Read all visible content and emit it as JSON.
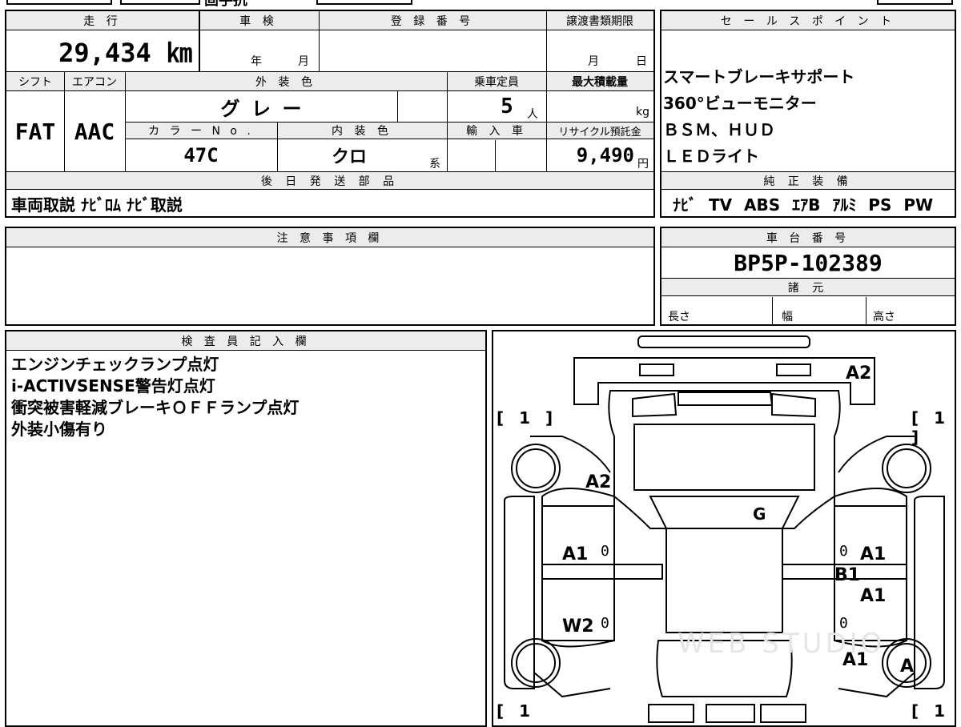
{
  "top_strip_text": "固手抗",
  "main": {
    "mileage_label": "走 行",
    "mileage_value": "29,434 ㎞",
    "inspection_label": "車 検",
    "inspection_year": "年",
    "inspection_month": "月",
    "registration_label": "登 録 番 号",
    "transfer_label": "譲渡書類期限",
    "transfer_month": "月",
    "transfer_day": "日",
    "shift_label": "シフト",
    "ac_label": "エアコン",
    "exterior_label": "外 装 色",
    "capacity_label": "乗車定員",
    "load_label": "最大積載量",
    "shift_value": "FAT",
    "ac_value": "AAC",
    "exterior_value": "グ レ ー",
    "capacity_value": "5",
    "capacity_unit": "人",
    "load_unit": "kg",
    "color_no_label": "カ ラ ー N o .",
    "interior_label": "内 装 色",
    "import_label": "輸 入 車",
    "recycle_label": "リサイクル預託金",
    "color_no_value": "47C",
    "interior_value": "クロ",
    "interior_suffix": "系",
    "recycle_value": "9,490",
    "recycle_unit": "円",
    "later_parts_label": "後 日 発 送 部 品",
    "later_parts_value": "車両取説 ﾅﾋﾞﾛﾑ ﾅﾋﾞ取説"
  },
  "sales": {
    "label": "セ ー ル ス ポ イ ン ト",
    "points": [
      "スマートブレーキサポート",
      "360°ビューモニター",
      "ＢＳＭ、ＨＵＤ",
      "ＬＥＤライト"
    ],
    "genuine_label": "純 正 装 備",
    "genuine_value": "ﾅﾋﾞ TV ABS ｴｱB ｱﾙﾐ PS PW"
  },
  "notes": {
    "label": "注 意 事 項 欄",
    "value": ""
  },
  "chassis": {
    "label": "車 台 番 号",
    "value": "BP5P-102389",
    "spec_label": "諸 元",
    "length_label": "長さ",
    "width_label": "幅",
    "height_label": "高さ"
  },
  "inspector": {
    "label": "検 査 員 記 入 欄",
    "lines": [
      "エンジンチェックランプ点灯",
      "i-ACTIVSENSE警告灯点灯",
      "衝突被害軽減ブレーキＯＦＦランプ点灯",
      "外装小傷有り"
    ]
  },
  "diagram": {
    "tire_tl": "[ 1 ]",
    "tire_tr": "[ 1 ]",
    "tire_bl": "[ 1",
    "tire_br": "[ 1",
    "marks": {
      "bonnet": "A2",
      "front_left": "A2",
      "windshield": "G",
      "left_front_door": "A1",
      "left_rear_door": "W2",
      "right_front_door": "A1",
      "right_pillar": "B1",
      "right_rear_door": "A1",
      "right_quarter": "A1",
      "right_rear_wheel": "A"
    },
    "zero": "0",
    "watermark": "WEB STUDIO"
  }
}
